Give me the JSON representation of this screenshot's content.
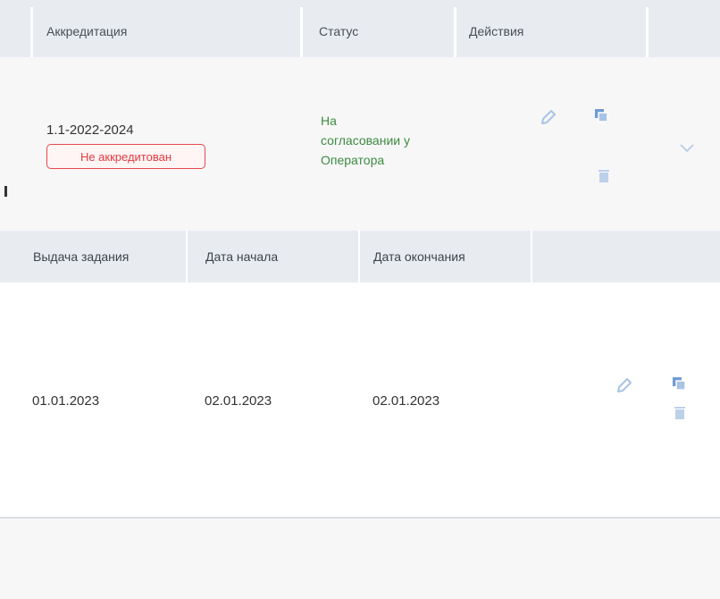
{
  "table": {
    "headers": {
      "accreditation": "Аккредитация",
      "status": "Статус",
      "actions": "Действия"
    },
    "row": {
      "accreditation_number": "1.1-2022-2024",
      "accreditation_badge": "Не аккредитован",
      "status_line1": "На",
      "status_line2": "согласовании у",
      "status_line3": "Оператора"
    }
  },
  "subtable": {
    "headers": {
      "issue": "Выдача задания",
      "start": "Дата начала",
      "end": "Дата окончания"
    },
    "row": {
      "issue": "01.01.2023",
      "start": "02.01.2023",
      "end": "02.01.2023"
    }
  },
  "colors": {
    "badge": "#e8474d",
    "status": "#3d8b40",
    "icon": "#a9c3e6",
    "header_bg": "#e8ecf1"
  },
  "icons": {
    "edit": "pencil-icon",
    "copy": "copy-icon",
    "delete": "trash-icon",
    "expand": "chevron-down-icon"
  }
}
